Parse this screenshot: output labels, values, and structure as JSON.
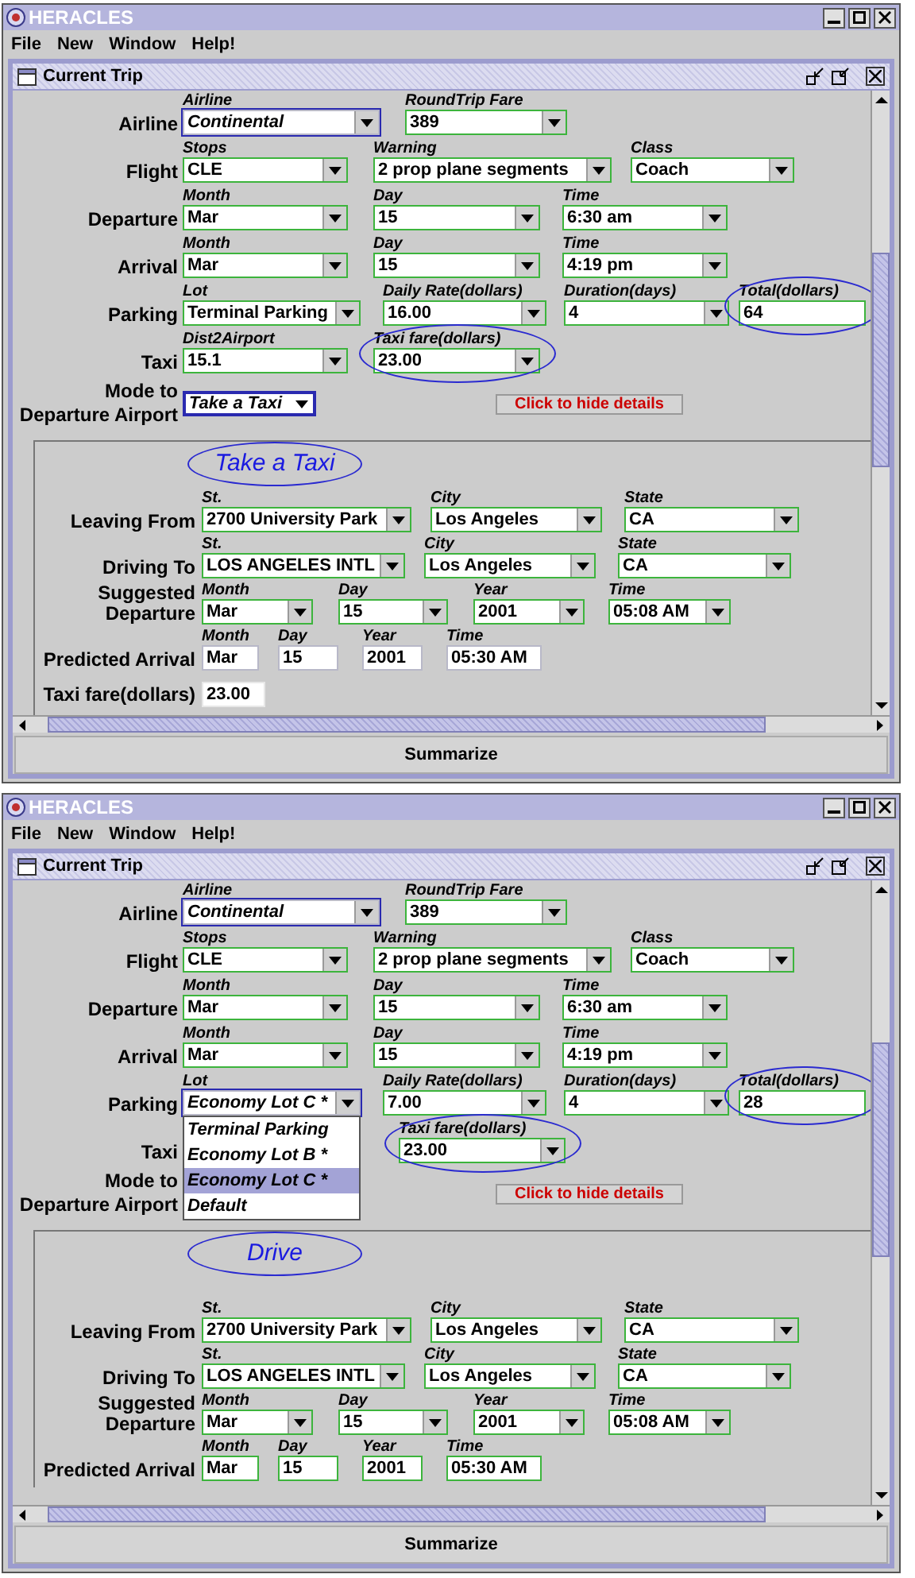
{
  "windows": [
    {
      "title": "HERACLES",
      "menu": [
        "File",
        "New",
        "Window",
        "Help!"
      ],
      "frame_title": "Current Trip",
      "rows": [
        {
          "label": "Airline",
          "fields": [
            {
              "caption": "Airline",
              "value": "Continental",
              "kind": "combo",
              "focused": true,
              "outlined": false,
              "circled": false
            },
            {
              "caption": "RoundTrip Fare",
              "value": "389",
              "kind": "combo",
              "focused": false,
              "outlined": true,
              "circled": false
            }
          ]
        },
        {
          "label": "Flight",
          "fields": [
            {
              "caption": "Stops",
              "value": "CLE",
              "kind": "combo",
              "focused": false,
              "outlined": true,
              "circled": false
            },
            {
              "caption": "Warning",
              "value": "2 prop plane segments",
              "kind": "combo",
              "focused": false,
              "outlined": true,
              "circled": false
            },
            {
              "caption": "Class",
              "value": "Coach",
              "kind": "combo",
              "focused": false,
              "outlined": true,
              "circled": false
            }
          ]
        },
        {
          "label": "Departure",
          "fields": [
            {
              "caption": "Month",
              "value": "Mar",
              "kind": "combo",
              "focused": false,
              "outlined": true,
              "circled": false
            },
            {
              "caption": "Day",
              "value": "15",
              "kind": "combo",
              "focused": false,
              "outlined": true,
              "circled": false
            },
            {
              "caption": "Time",
              "value": "6:30 am",
              "kind": "combo",
              "focused": false,
              "outlined": true,
              "circled": false
            }
          ]
        },
        {
          "label": "Arrival",
          "fields": [
            {
              "caption": "Month",
              "value": "Mar",
              "kind": "combo",
              "focused": false,
              "outlined": true,
              "circled": false
            },
            {
              "caption": "Day",
              "value": "15",
              "kind": "combo",
              "focused": false,
              "outlined": true,
              "circled": false
            },
            {
              "caption": "Time",
              "value": "4:19 pm",
              "kind": "combo",
              "focused": false,
              "outlined": true,
              "circled": false
            }
          ]
        },
        {
          "label": "Parking",
          "fields": [
            {
              "caption": "Lot",
              "value": "Terminal Parking",
              "kind": "combo",
              "focused": false,
              "outlined": true,
              "circled": false
            },
            {
              "caption": "Daily Rate(dollars)",
              "value": "16.00",
              "kind": "combo",
              "focused": false,
              "outlined": true,
              "circled": false
            },
            {
              "caption": "Duration(days)",
              "value": "4",
              "kind": "combo",
              "focused": false,
              "outlined": true,
              "circled": false
            },
            {
              "caption": "Total(dollars)",
              "value": "64",
              "kind": "text",
              "focused": false,
              "outlined": true,
              "circled": true
            }
          ]
        },
        {
          "label": "Taxi",
          "fields": [
            {
              "caption": "Dist2Airport",
              "value": "15.1",
              "kind": "combo",
              "focused": false,
              "outlined": true,
              "circled": false
            },
            {
              "caption": "Taxi fare(dollars)",
              "value": "23.00",
              "kind": "combo",
              "focused": false,
              "outlined": true,
              "circled": true
            }
          ]
        }
      ],
      "mode": {
        "label": "Mode to Departure Airport",
        "value": "Take a Taxi"
      },
      "hide_button": "Click to hide details",
      "details": {
        "heading": "Take a Taxi",
        "rows": [
          {
            "label": "Leaving From",
            "fields": [
              {
                "caption": "St.",
                "value": "2700 University Park",
                "kind": "combo",
                "focused": false,
                "outlined": true,
                "circled": false
              },
              {
                "caption": "City",
                "value": "Los Angeles",
                "kind": "combo",
                "focused": false,
                "outlined": true,
                "circled": false
              },
              {
                "caption": "State",
                "value": "CA",
                "kind": "combo",
                "focused": false,
                "outlined": true,
                "circled": false
              }
            ]
          },
          {
            "label": "Driving To",
            "fields": [
              {
                "caption": "St.",
                "value": "LOS ANGELES INTL",
                "kind": "combo",
                "focused": false,
                "outlined": true,
                "circled": false
              },
              {
                "caption": "City",
                "value": "Los Angeles",
                "kind": "combo",
                "focused": false,
                "outlined": true,
                "circled": false
              },
              {
                "caption": "State",
                "value": "CA",
                "kind": "combo",
                "focused": false,
                "outlined": true,
                "circled": false
              }
            ]
          },
          {
            "label": "Suggested Departure",
            "fields": [
              {
                "caption": "Month",
                "value": "Mar",
                "kind": "combo",
                "focused": false,
                "outlined": true,
                "circled": false
              },
              {
                "caption": "Day",
                "value": "15",
                "kind": "combo",
                "focused": false,
                "outlined": true,
                "circled": false
              },
              {
                "caption": "Year",
                "value": "2001",
                "kind": "combo",
                "focused": false,
                "outlined": true,
                "circled": false
              },
              {
                "caption": "Time",
                "value": "05:08 AM",
                "kind": "combo",
                "focused": false,
                "outlined": true,
                "circled": false
              }
            ]
          },
          {
            "label": "Predicted Arrival",
            "fields": [
              {
                "caption": "Month",
                "value": "Mar",
                "kind": "text",
                "focused": false,
                "outlined": false,
                "circled": false
              },
              {
                "caption": "Day",
                "value": "15",
                "kind": "text",
                "focused": false,
                "outlined": false,
                "circled": false
              },
              {
                "caption": "Year",
                "value": "2001",
                "kind": "text",
                "focused": false,
                "outlined": false,
                "circled": false
              },
              {
                "caption": "Time",
                "value": "05:30 AM",
                "kind": "text",
                "focused": false,
                "outlined": false,
                "circled": false
              }
            ]
          }
        ],
        "fare": {
          "label": "Taxi fare(dollars)",
          "value": "23.00"
        }
      },
      "summarize": "Summarize"
    },
    {
      "title": "HERACLES",
      "menu": [
        "File",
        "New",
        "Window",
        "Help!"
      ],
      "frame_title": "Current Trip",
      "rows": [
        {
          "label": "Airline",
          "fields": [
            {
              "caption": "Airline",
              "value": "Continental",
              "kind": "combo",
              "focused": true,
              "outlined": false,
              "circled": false
            },
            {
              "caption": "RoundTrip Fare",
              "value": "389",
              "kind": "combo",
              "focused": false,
              "outlined": true,
              "circled": false
            }
          ]
        },
        {
          "label": "Flight",
          "fields": [
            {
              "caption": "Stops",
              "value": "CLE",
              "kind": "combo",
              "focused": false,
              "outlined": true,
              "circled": false
            },
            {
              "caption": "Warning",
              "value": "2 prop plane segments",
              "kind": "combo",
              "focused": false,
              "outlined": true,
              "circled": false
            },
            {
              "caption": "Class",
              "value": "Coach",
              "kind": "combo",
              "focused": false,
              "outlined": true,
              "circled": false
            }
          ]
        },
        {
          "label": "Departure",
          "fields": [
            {
              "caption": "Month",
              "value": "Mar",
              "kind": "combo",
              "focused": false,
              "outlined": true,
              "circled": false
            },
            {
              "caption": "Day",
              "value": "15",
              "kind": "combo",
              "focused": false,
              "outlined": true,
              "circled": false
            },
            {
              "caption": "Time",
              "value": "6:30 am",
              "kind": "combo",
              "focused": false,
              "outlined": true,
              "circled": false
            }
          ]
        },
        {
          "label": "Arrival",
          "fields": [
            {
              "caption": "Month",
              "value": "Mar",
              "kind": "combo",
              "focused": false,
              "outlined": true,
              "circled": false
            },
            {
              "caption": "Day",
              "value": "15",
              "kind": "combo",
              "focused": false,
              "outlined": true,
              "circled": false
            },
            {
              "caption": "Time",
              "value": "4:19 pm",
              "kind": "combo",
              "focused": false,
              "outlined": true,
              "circled": false
            }
          ]
        },
        {
          "label": "Parking",
          "fields": [
            {
              "caption": "Lot",
              "value": "Economy Lot C *",
              "kind": "combo",
              "focused": true,
              "outlined": false,
              "circled": false
            },
            {
              "caption": "Daily Rate(dollars)",
              "value": "7.00",
              "kind": "combo",
              "focused": false,
              "outlined": true,
              "circled": false
            },
            {
              "caption": "Duration(days)",
              "value": "4",
              "kind": "combo",
              "focused": false,
              "outlined": true,
              "circled": false
            },
            {
              "caption": "Total(dollars)",
              "value": "28",
              "kind": "text",
              "focused": false,
              "outlined": true,
              "circled": true
            }
          ]
        },
        {
          "label": "Taxi",
          "fields": [
            {
              "caption": "Taxi fare(dollars)",
              "value": "23.00",
              "kind": "combo",
              "focused": false,
              "outlined": true,
              "circled": true
            }
          ]
        }
      ],
      "dropdown": [
        {
          "label": "Terminal Parking",
          "selected": false
        },
        {
          "label": "Economy Lot B *",
          "selected": false
        },
        {
          "label": "Economy Lot C *",
          "selected": true
        },
        {
          "label": "Default",
          "selected": false
        }
      ],
      "mode": {
        "label": "Mode to Departure Airport"
      },
      "hide_button": "Click to hide details",
      "details": {
        "heading": "Drive",
        "rows": [
          {
            "label": "Leaving From",
            "fields": [
              {
                "caption": "St.",
                "value": "2700 University Park",
                "kind": "combo",
                "focused": false,
                "outlined": true,
                "circled": false
              },
              {
                "caption": "City",
                "value": "Los Angeles",
                "kind": "combo",
                "focused": false,
                "outlined": true,
                "circled": false
              },
              {
                "caption": "State",
                "value": "CA",
                "kind": "combo",
                "focused": false,
                "outlined": true,
                "circled": false
              }
            ]
          },
          {
            "label": "Driving To",
            "fields": [
              {
                "caption": "St.",
                "value": "LOS ANGELES INTL",
                "kind": "combo",
                "focused": false,
                "outlined": true,
                "circled": false
              },
              {
                "caption": "City",
                "value": "Los Angeles",
                "kind": "combo",
                "focused": false,
                "outlined": true,
                "circled": false
              },
              {
                "caption": "State",
                "value": "CA",
                "kind": "combo",
                "focused": false,
                "outlined": true,
                "circled": false
              }
            ]
          },
          {
            "label": "Suggested Departure",
            "fields": [
              {
                "caption": "Month",
                "value": "Mar",
                "kind": "combo",
                "focused": false,
                "outlined": true,
                "circled": false
              },
              {
                "caption": "Day",
                "value": "15",
                "kind": "combo",
                "focused": false,
                "outlined": true,
                "circled": false
              },
              {
                "caption": "Year",
                "value": "2001",
                "kind": "combo",
                "focused": false,
                "outlined": true,
                "circled": false
              },
              {
                "caption": "Time",
                "value": "05:08 AM",
                "kind": "combo",
                "focused": false,
                "outlined": true,
                "circled": false
              }
            ]
          },
          {
            "label": "Predicted Arrival",
            "fields": [
              {
                "caption": "Month",
                "value": "Mar",
                "kind": "text",
                "focused": false,
                "outlined": true,
                "circled": false
              },
              {
                "caption": "Day",
                "value": "15",
                "kind": "text",
                "focused": false,
                "outlined": true,
                "circled": false
              },
              {
                "caption": "Year",
                "value": "2001",
                "kind": "text",
                "focused": false,
                "outlined": true,
                "circled": false
              },
              {
                "caption": "Time",
                "value": "05:30 AM",
                "kind": "text",
                "focused": false,
                "outlined": true,
                "circled": false
              }
            ]
          }
        ]
      },
      "summarize": "Summarize"
    }
  ]
}
